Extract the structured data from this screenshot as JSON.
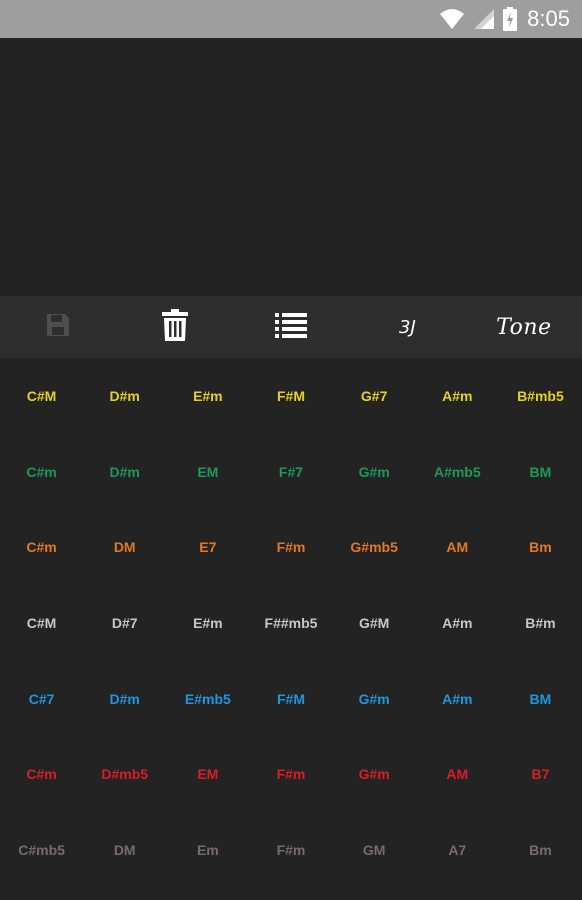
{
  "status_bar": {
    "time": "8:05",
    "icons": [
      "wifi-icon",
      "signal-icon",
      "battery-charging-icon"
    ]
  },
  "toolbar": {
    "save_icon": "save-icon",
    "delete_icon": "trash-icon",
    "list_icon": "list-icon",
    "tj_label": "3J",
    "tone_label": "Tone"
  },
  "chord_rows": [
    {
      "color": "#e6d21e",
      "chords": [
        "C#M",
        "D#m",
        "E#m",
        "F#M",
        "G#7",
        "A#m",
        "B#mb5"
      ]
    },
    {
      "color": "#1a9a55",
      "chords": [
        "C#m",
        "D#m",
        "EM",
        "F#7",
        "G#m",
        "A#mb5",
        "BM"
      ]
    },
    {
      "color": "#e07828",
      "chords": [
        "C#m",
        "DM",
        "E7",
        "F#m",
        "G#mb5",
        "AM",
        "Bm"
      ]
    },
    {
      "color": "#c8c8c8",
      "chords": [
        "C#M",
        "D#7",
        "E#m",
        "F##mb5",
        "G#M",
        "A#m",
        "B#m"
      ]
    },
    {
      "color": "#1e96e0",
      "chords": [
        "C#7",
        "D#m",
        "E#mb5",
        "F#M",
        "G#m",
        "A#m",
        "BM"
      ]
    },
    {
      "color": "#d81e28",
      "chords": [
        "C#m",
        "D#mb5",
        "EM",
        "F#m",
        "G#m",
        "AM",
        "B7"
      ]
    },
    {
      "color": "#7a6a6a",
      "chords": [
        "C#mb5",
        "DM",
        "Em",
        "F#m",
        "GM",
        "A7",
        "Bm"
      ]
    }
  ]
}
